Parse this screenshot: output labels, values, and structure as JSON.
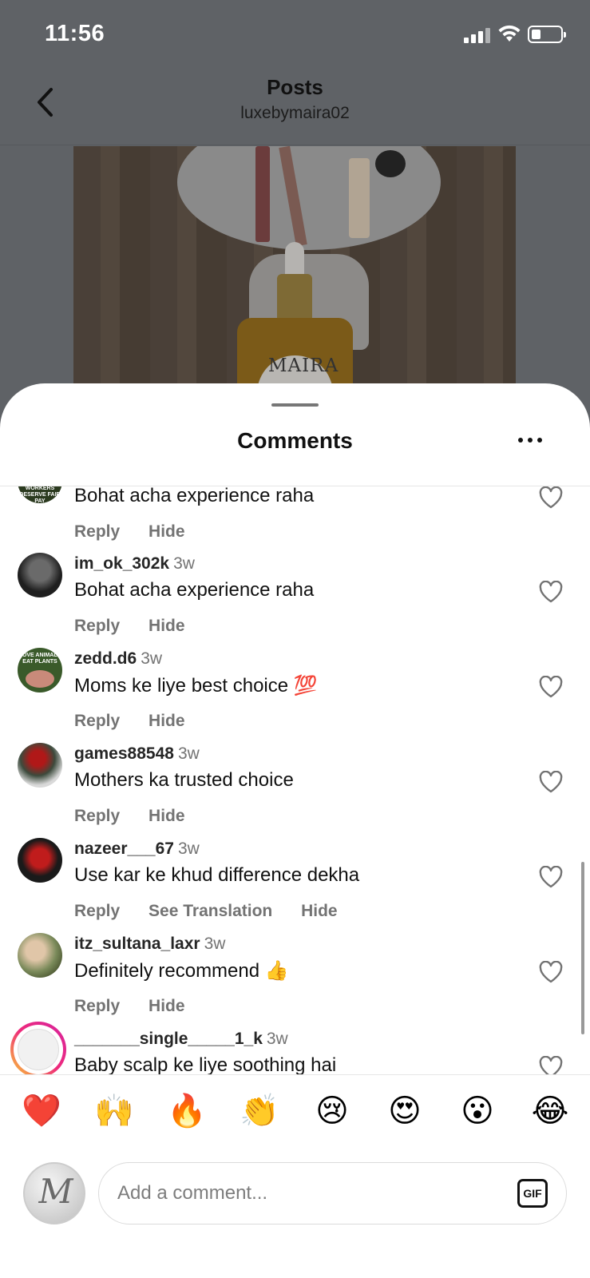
{
  "status_bar": {
    "time": "11:56"
  },
  "nav": {
    "title": "Posts",
    "subtitle": "luxebymaira02"
  },
  "post": {
    "label_text": "MAIRA"
  },
  "sheet": {
    "title": "Comments"
  },
  "comments": [
    {
      "username": "",
      "time": "",
      "text": "Bohat acha experience raha",
      "actions": [
        "Reply",
        "Hide"
      ]
    },
    {
      "username": "im_ok_302k",
      "time": "3w",
      "text": "Bohat acha experience raha",
      "actions": [
        "Reply",
        "Hide"
      ]
    },
    {
      "username": "zedd.d6",
      "time": "3w",
      "text": "Moms ke liye best choice 💯",
      "actions": [
        "Reply",
        "Hide"
      ]
    },
    {
      "username": "games88548",
      "time": "3w",
      "text": "Mothers ka trusted choice",
      "actions": [
        "Reply",
        "Hide"
      ]
    },
    {
      "username": "nazeer___67",
      "time": "3w",
      "text": "Use kar ke khud difference dekha",
      "actions": [
        "Reply",
        "See Translation",
        "Hide"
      ]
    },
    {
      "username": "itz_sultana_laxr",
      "time": "3w",
      "text": "Definitely recommend 👍",
      "actions": [
        "Reply",
        "Hide"
      ]
    },
    {
      "username": "_______single_____1_k",
      "time": "3w",
      "text": "Baby scalp ke liye soothing hai",
      "actions": []
    }
  ],
  "avatar_texts": {
    "workers": "WORKERS DESERVE FAIR PAY",
    "animals": "LOVE ANIMALS EAT PLANTS"
  },
  "emoji_bar": [
    "❤️",
    "🙌",
    "🔥",
    "👏",
    "😢",
    "😍",
    "😮",
    "😂"
  ],
  "composer": {
    "placeholder": "Add a comment...",
    "gif_label": "GIF",
    "avatar_letter": "M"
  },
  "colors": {
    "secondary_text": "#737373",
    "heart_red": "#e0245e",
    "story_ring": "#d6249f"
  }
}
